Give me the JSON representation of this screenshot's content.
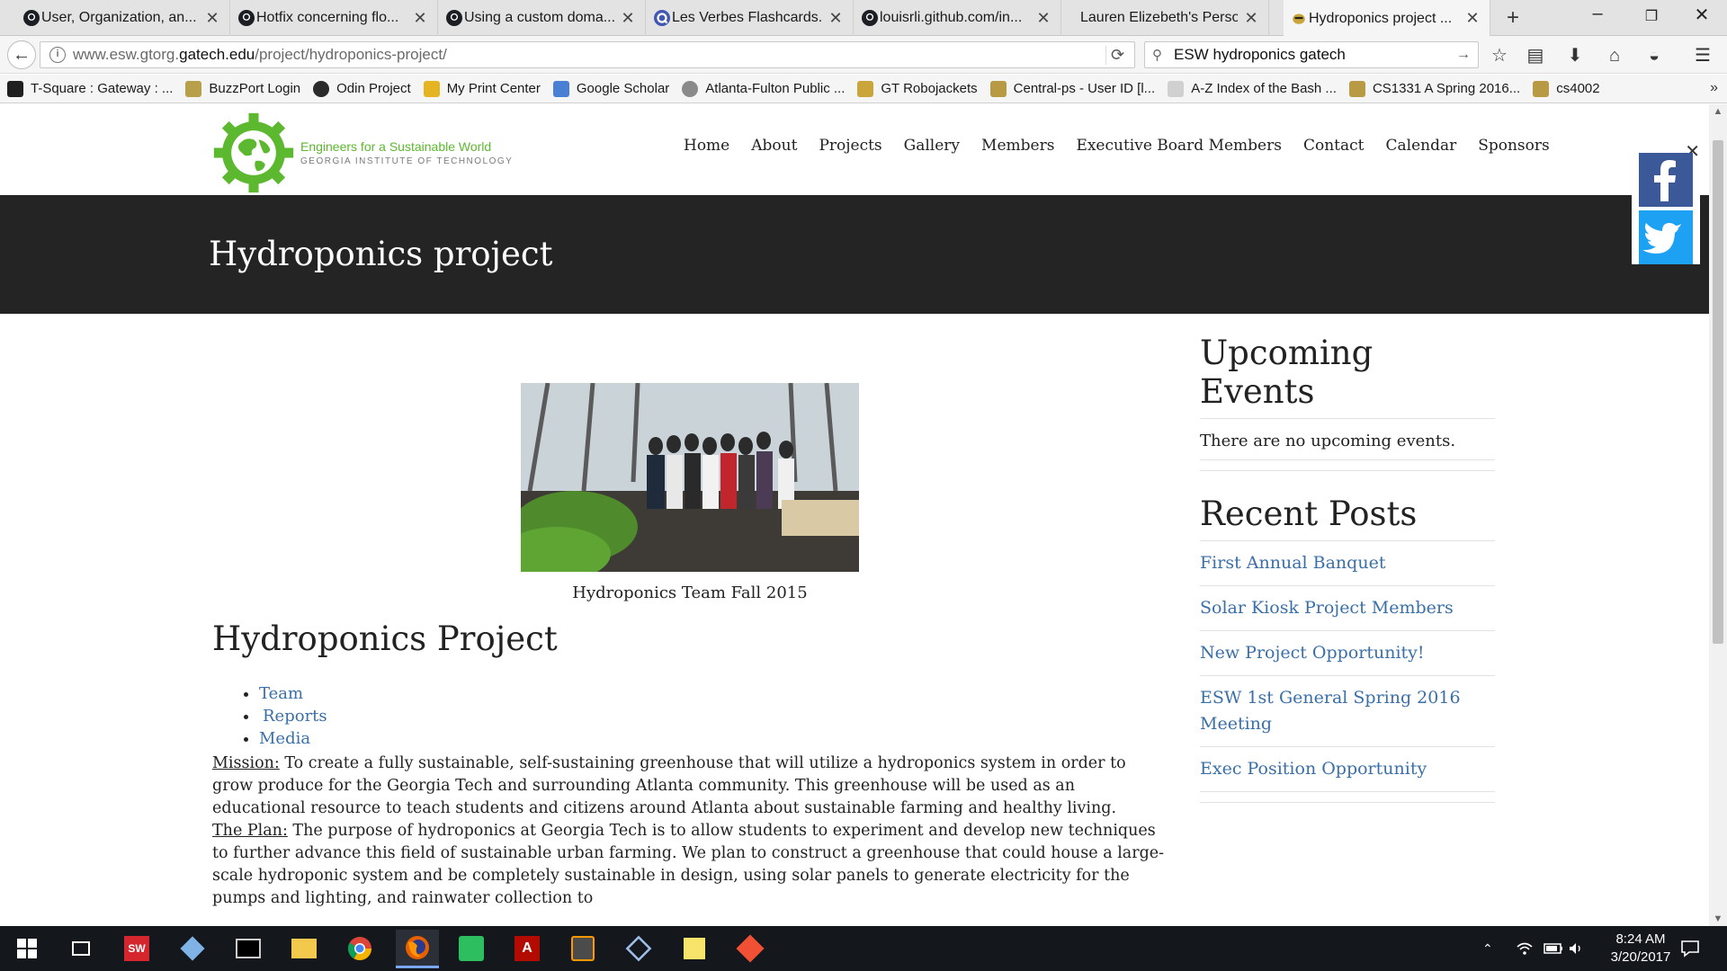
{
  "browser": {
    "tabs": [
      {
        "title": "User, Organization, an...",
        "icon": "github-icon"
      },
      {
        "title": "Hotfix concerning flo...",
        "icon": "github-icon"
      },
      {
        "title": "Using a custom doma...",
        "icon": "github-icon"
      },
      {
        "title": "Les Verbes Flashcards...",
        "icon": "quizlet-icon"
      },
      {
        "title": "louisrli.github.com/in...",
        "icon": "github-icon"
      },
      {
        "title": "Lauren Elizebeth's Person...",
        "icon": "none"
      },
      {
        "title": "Hydroponics project ...",
        "icon": "buzz-icon"
      }
    ],
    "url_prefix": "www.esw.gtorg.",
    "url_domain": "gatech.edu",
    "url_path": "/project/hydroponics-project/",
    "search_query": "ESW hydroponics gatech",
    "bookmarks": [
      {
        "label": "T-Square : Gateway : ...",
        "color": "#1f1f1f"
      },
      {
        "label": "BuzzPort Login",
        "color": "#b8a04a"
      },
      {
        "label": "Odin Project",
        "color": "#2b2b2b"
      },
      {
        "label": "My Print Center",
        "color": "#e6b422"
      },
      {
        "label": "Google Scholar",
        "color": "#4a7fd6"
      },
      {
        "label": "Atlanta-Fulton Public ...",
        "color": "#8a8a8a"
      },
      {
        "label": "GT Robojackets",
        "color": "#c9a53a"
      },
      {
        "label": "Central-ps - User ID [l...",
        "color": "#b89a44"
      },
      {
        "label": "A-Z Index of the Bash ...",
        "color": "#d0d0d0"
      },
      {
        "label": "CS1331 A Spring 2016...",
        "color": "#b89a44"
      },
      {
        "label": "cs4002",
        "color": "#b89a44"
      }
    ]
  },
  "site": {
    "logo_line1": "Engineers for a Sustainable World",
    "logo_line2": "GEORGIA INSTITUTE OF TECHNOLOGY",
    "brand_color": "#5cb82e",
    "nav": [
      "Home",
      "About",
      "Projects",
      "Gallery",
      "Members",
      "Executive Board Members",
      "Contact",
      "Calendar",
      "Sponsors"
    ],
    "banner_title": "Hydroponics project"
  },
  "main": {
    "photo_caption": "Hydroponics Team Fall 2015",
    "project_title": "Hydroponics Project",
    "project_links": [
      "Team",
      "Reports",
      "Media"
    ],
    "mission_label": "Mission:",
    "mission_text": " To create a fully sustainable, self-sustaining greenhouse that will utilize a hydroponics system in order to grow produce for the Georgia Tech and surrounding Atlanta community. This greenhouse will be used as an educational resource to teach students and citizens around Atlanta about sustainable farming and healthy living.",
    "plan_label": "The Plan:",
    "plan_text": " The purpose of hydroponics at Georgia Tech is to allow students to experiment and develop new techniques to further advance this field of sustainable urban farming. We plan to construct a greenhouse that could house a large-scale hydroponic system and  be completely sustainable in design, using solar panels to generate electricity for the pumps and lighting, and rainwater collection to"
  },
  "sidebar": {
    "events_heading": "Upcoming Events",
    "events_empty": "There are no upcoming events.",
    "posts_heading": "Recent Posts",
    "posts": [
      "First Annual Banquet",
      "Solar Kiosk Project Members",
      "New Project Opportunity!",
      "ESW 1st General Spring 2016 Meeting",
      "Exec Position Opportunity"
    ]
  },
  "taskbar": {
    "time": "8:24 AM",
    "date": "3/20/2017"
  }
}
